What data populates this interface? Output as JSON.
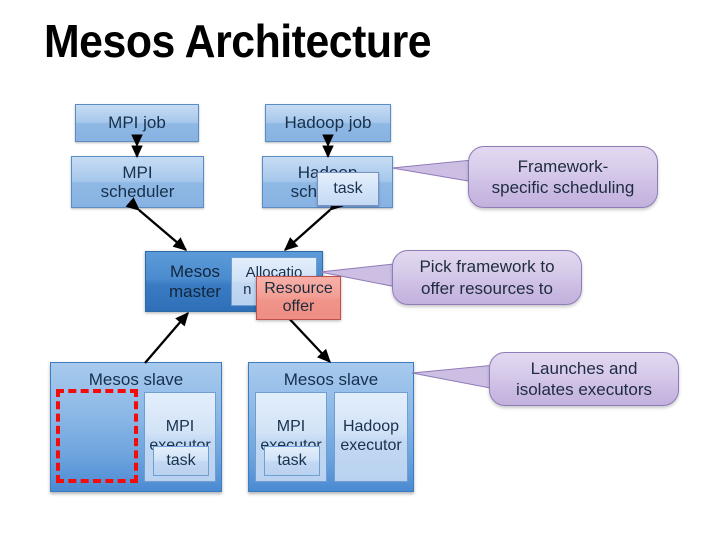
{
  "title": "Mesos Architecture",
  "diagram": {
    "frameworks": [
      {
        "job_label": "MPI job",
        "scheduler_label": "MPI\nscheduler"
      },
      {
        "job_label": "Hadoop job",
        "scheduler_label": "Hadoop\nscheduler"
      }
    ],
    "scheduler_task_label": "task",
    "master": {
      "label": "Mesos\nmaster",
      "allocation_module_label": "Allocatio\nn module",
      "resource_offer_label": "Resource\noffer"
    },
    "slaves": [
      {
        "label": "Mesos slave",
        "has_empty_slot": true,
        "executors": [
          {
            "label": "MPI\nexecutor",
            "task_label": "task"
          }
        ]
      },
      {
        "label": "Mesos slave",
        "has_empty_slot": false,
        "executors": [
          {
            "label": "MPI\nexecutor",
            "task_label": "task"
          },
          {
            "label": "Hadoop\nexecutor",
            "task_label": ""
          }
        ]
      }
    ],
    "callouts": [
      {
        "text": "Framework-\nspecific scheduling"
      },
      {
        "text": "Pick framework to\noffer resources to"
      },
      {
        "text": "Launches and\nisolates executors"
      }
    ]
  },
  "colors": {
    "accent_blue": "#4a8ad2",
    "light_blue": "#a6c8ec",
    "pale_blue": "#d2e3f7",
    "master_blue": "#3a7cc4",
    "offer_red": "#f0948a",
    "dashed_red": "#f20c0c",
    "callout_purple": "#cbbce3",
    "background": "#ffffff",
    "text": "#17304c"
  }
}
